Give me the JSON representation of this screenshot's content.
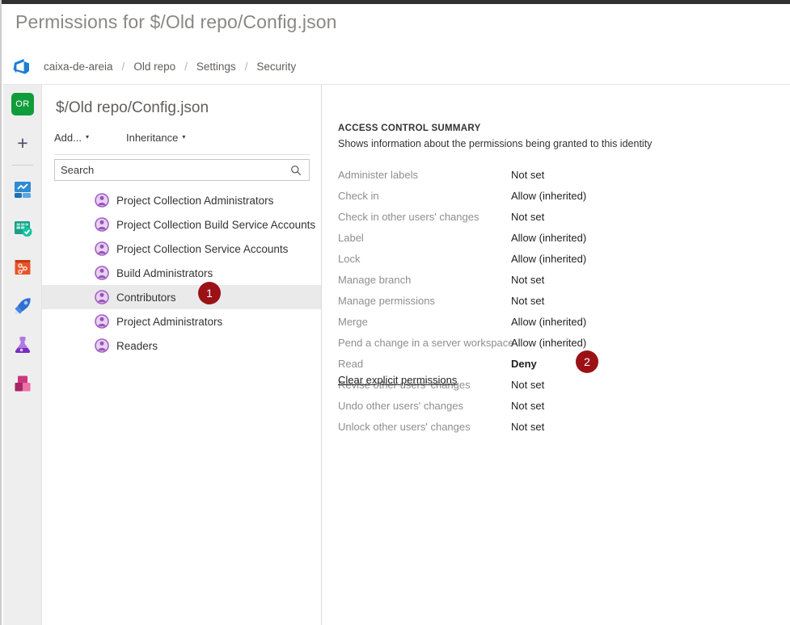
{
  "window": {
    "title": "Permissions for $/Old repo/Config.json"
  },
  "breadcrumb": {
    "logo_icon": "azure-devops-logo-icon",
    "separator": "/",
    "items": [
      {
        "label": "caixa-de-areia"
      },
      {
        "label": "Old repo"
      },
      {
        "label": "Settings"
      },
      {
        "label": "Security"
      }
    ]
  },
  "rail": {
    "avatar": {
      "initials": "OR",
      "color": "#0f9d3a",
      "icon": "user-avatar-icon"
    },
    "new_button": {
      "glyph": "+",
      "icon": "plus-icon"
    },
    "items": [
      {
        "name": "overview",
        "icon": "overview-icon"
      },
      {
        "name": "boards",
        "icon": "boards-icon"
      },
      {
        "name": "repos",
        "icon": "repos-icon"
      },
      {
        "name": "pipelines",
        "icon": "pipelines-rocket-icon"
      },
      {
        "name": "test-plans",
        "icon": "test-plans-flask-icon"
      },
      {
        "name": "artifacts",
        "icon": "artifacts-boxes-icon"
      }
    ]
  },
  "identity_panel": {
    "title": "$/Old repo/Config.json",
    "toolbar": {
      "add_label": "Add...",
      "inheritance_label": "Inheritance",
      "caret": "▾"
    },
    "search": {
      "placeholder": "Search",
      "value": "",
      "icon": "search-icon"
    },
    "group_icon": "user-group-icon",
    "items": [
      {
        "label": "Project Collection Administrators",
        "selected": false
      },
      {
        "label": "Project Collection Build Service Accounts",
        "selected": false
      },
      {
        "label": "Project Collection Service Accounts",
        "selected": false
      },
      {
        "label": "Build Administrators",
        "selected": false
      },
      {
        "label": "Contributors",
        "selected": true
      },
      {
        "label": "Project Administrators",
        "selected": false
      },
      {
        "label": "Readers",
        "selected": false
      }
    ]
  },
  "summary_panel": {
    "heading": "ACCESS CONTROL SUMMARY",
    "subheading": "Shows information about the permissions being granted to this identity",
    "permissions": [
      {
        "name": "Administer labels",
        "value": "Not set",
        "bold": false
      },
      {
        "name": "Check in",
        "value": "Allow (inherited)",
        "bold": false
      },
      {
        "name": "Check in other users' changes",
        "value": "Not set",
        "bold": false
      },
      {
        "name": "Label",
        "value": "Allow (inherited)",
        "bold": false
      },
      {
        "name": "Lock",
        "value": "Allow (inherited)",
        "bold": false
      },
      {
        "name": "Manage branch",
        "value": "Not set",
        "bold": false
      },
      {
        "name": "Manage permissions",
        "value": "Not set",
        "bold": false
      },
      {
        "name": "Merge",
        "value": "Allow (inherited)",
        "bold": false
      },
      {
        "name": "Pend a change in a server workspace",
        "value": "Allow (inherited)",
        "bold": false
      },
      {
        "name": "Read",
        "value": "Deny",
        "bold": true
      },
      {
        "name": "Revise other users' changes",
        "value": "Not set",
        "bold": false
      },
      {
        "name": "Undo other users' changes",
        "value": "Not set",
        "bold": false
      },
      {
        "name": "Unlock other users' changes",
        "value": "Not set",
        "bold": false
      }
    ],
    "clear_link": "Clear explicit permissions"
  },
  "callouts": {
    "badge_color": "#9b1116",
    "items": [
      {
        "number": "1",
        "target": "contributors-identity-row"
      },
      {
        "number": "2",
        "target": "read-permission-value"
      }
    ]
  }
}
